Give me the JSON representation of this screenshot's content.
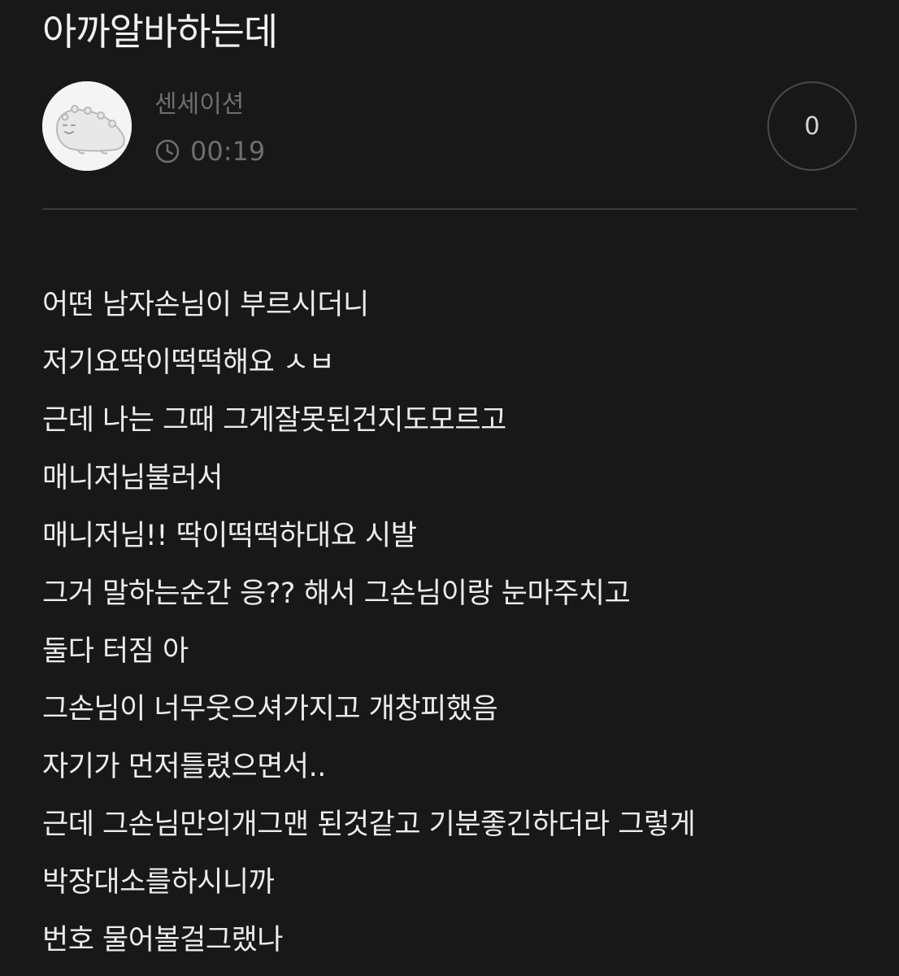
{
  "post": {
    "title": "아까알바하는데",
    "author": {
      "name": "센세이션",
      "avatar_icon": "dinosaur-avatar-icon"
    },
    "time": "00:19",
    "time_icon": "clock-icon",
    "like_count": "0",
    "body_lines": [
      "어떤 남자손님이 부르시더니",
      "저기요딱이떡떡해요 ㅅㅂ",
      "근데 나는 그때 그게잘못된건지도모르고",
      "매니저님불러서",
      "매니저님!! 딱이떡떡하대요 시발",
      "그거 말하는순간 응?? 해서 그손님이랑 눈마주치고",
      "둘다 터짐 아",
      "그손님이 너무웃으셔가지고 개창피했음",
      "자기가 먼저틀렸으면서..",
      "근데 그손님만의개그맨 된것같고 기분좋긴하더라 그렇게",
      "박장대소를하시니까",
      "번호 물어볼걸그랬나"
    ]
  },
  "colors": {
    "background": "#181818",
    "text": "#ececec",
    "muted": "#6e6e6e",
    "divider": "#3a3a3a"
  }
}
